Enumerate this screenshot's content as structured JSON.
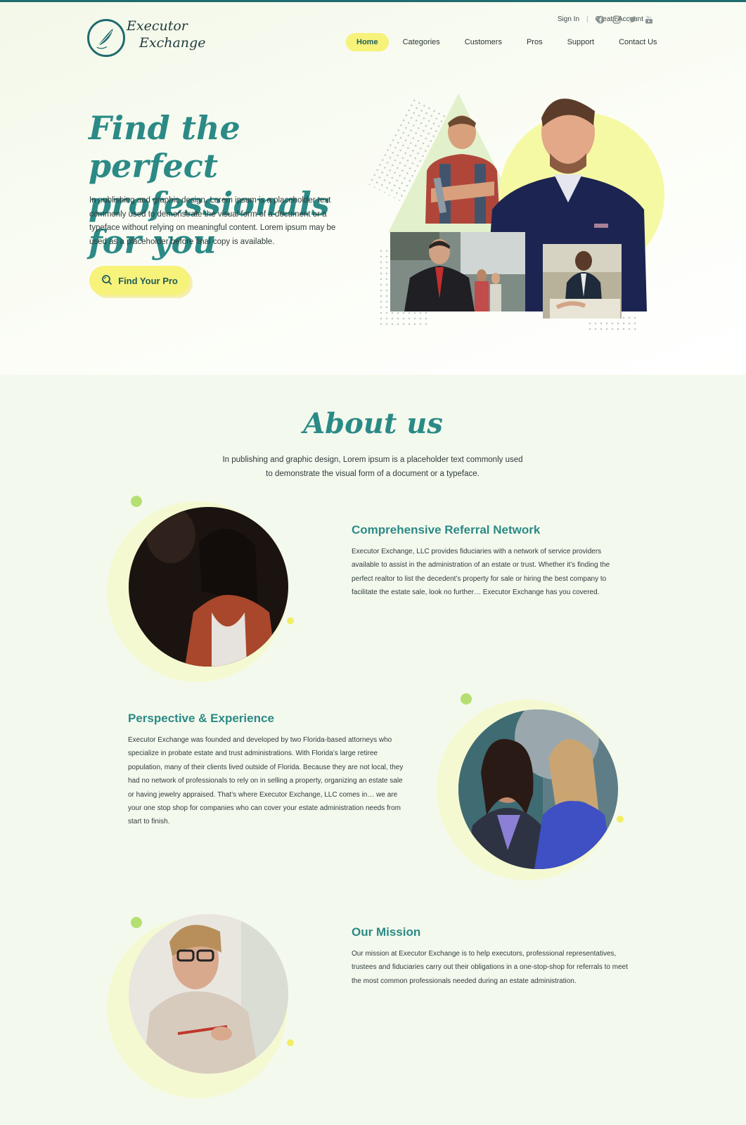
{
  "brand": {
    "logo_line1": "Executor",
    "logo_line2": "Exchange",
    "accent": "#2b8a86",
    "highlight": "#f7f27a"
  },
  "utility": {
    "sign_in": "Sign In",
    "separator": "|",
    "create_account": "Create Account"
  },
  "socials": [
    "facebook-icon",
    "instagram-icon",
    "twitter-icon",
    "youtube-icon"
  ],
  "nav": {
    "items": [
      {
        "label": "Home"
      },
      {
        "label": "Categories"
      },
      {
        "label": "Customers"
      },
      {
        "label": "Pros"
      },
      {
        "label": "Support"
      },
      {
        "label": "Contact Us"
      }
    ]
  },
  "hero": {
    "title": "Find the perfect professionals for you",
    "description": "In publishing and graphic design, Lorem ipsum is a placeholder text commonly used to demonstrate the visual form of a document or a typeface without relying on meaningful content. Lorem ipsum may be used as a placeholder before final copy is available.",
    "cta": "Find Your Pro",
    "cta_icon": "search-icon"
  },
  "about": {
    "title": "About us",
    "description": "In publishing and graphic design, Lorem ipsum is a placeholder text commonly used to demonstrate the visual form of a document or a typeface.",
    "features": [
      {
        "title": "Comprehensive Referral Network",
        "text": "Executor Exchange, LLC provides fiduciaries with a network of service providers available to assist in the administration of an estate or trust.  Whether it’s finding the perfect realtor to list the decedent’s property for sale or hiring the best company to facilitate the estate sale, look no further… Executor Exchange has you covered."
      },
      {
        "title": "Perspective & Experience",
        "text": "Executor Exchange was founded and developed by two Florida-based attorneys who specialize in probate estate and trust administrations.  With Florida’s large retiree population, many of their clients lived outside of Florida.  Because they are not local, they had no network of professionals to rely on in selling a property, organizing an estate sale or having jewelry appraised.  That’s where Executor Exchange, LLC comes in… we are your one stop shop for companies who can cover your estate administration needs from start to finish."
      },
      {
        "title": "Our Mission",
        "text": "Our mission at Executor Exchange is to help executors, professional representatives, trustees and fiduciaries carry out their obligations in a one-stop-shop for referrals to meet the most common professionals needed during an estate administration."
      }
    ]
  }
}
